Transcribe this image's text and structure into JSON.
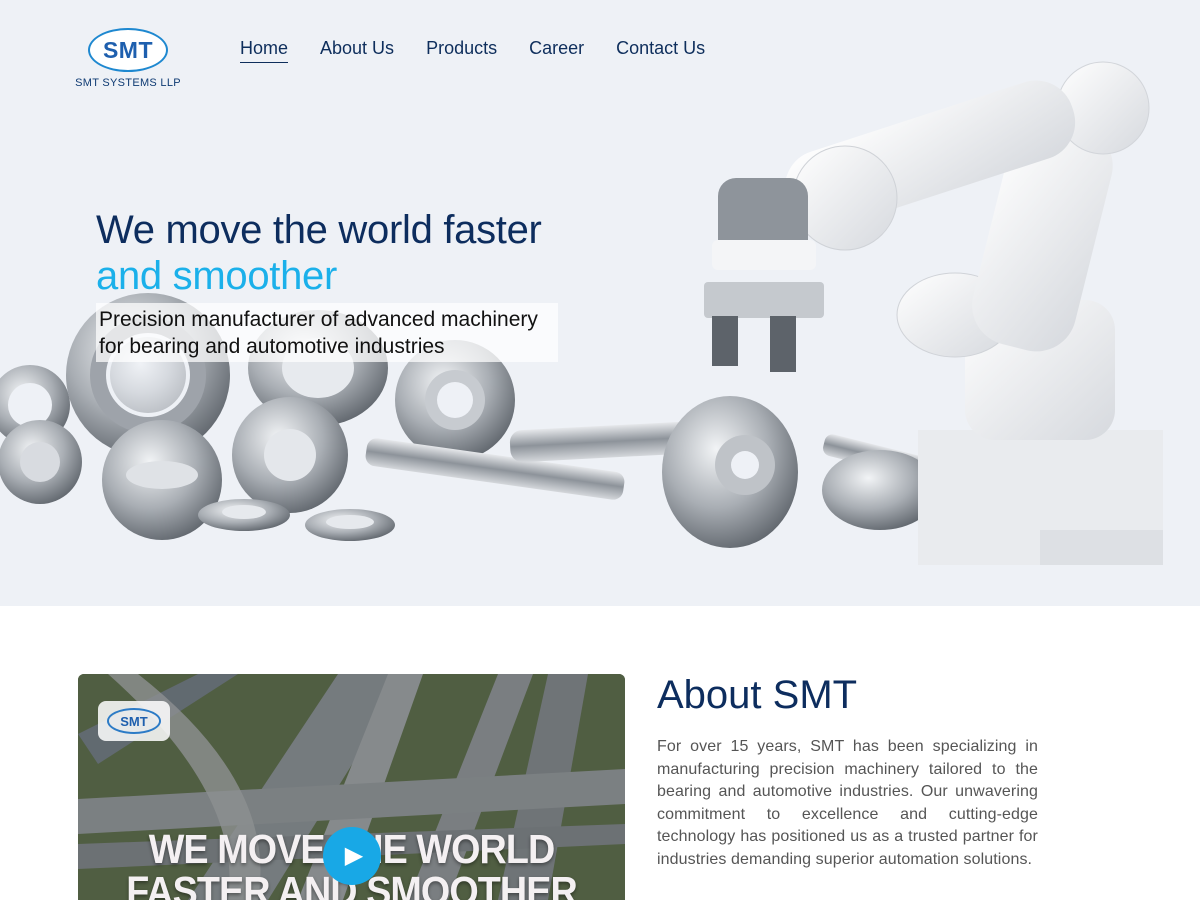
{
  "brand": {
    "logo_text": "SMT",
    "company_name": "SMT SYSTEMS LLP",
    "color_primary": "#0d2d5e",
    "color_accent": "#1bb0ea"
  },
  "nav": {
    "items": [
      {
        "label": "Home",
        "active": true
      },
      {
        "label": "About Us",
        "active": false
      },
      {
        "label": "Products",
        "active": false
      },
      {
        "label": "Career",
        "active": false
      },
      {
        "label": "Contact Us",
        "active": false
      }
    ]
  },
  "hero": {
    "title_line1": "We move the world faster",
    "title_line2": "and smoother",
    "subtitle": "Precision manufacturer of advanced machinery for bearing and automotive industries"
  },
  "video": {
    "logo_text": "SMT",
    "caption_line1": "WE MOVE THE WORLD",
    "caption_line2": "FASTER AND SMOOTHER",
    "play_icon": "play-icon"
  },
  "about": {
    "title": "About SMT",
    "body": "For over 15 years, SMT has been specializing in manufacturing precision machinery tailored to the bearing and automotive industries. Our unwavering commitment to excellence and cutting-edge technology has positioned us as a trusted partner for industries demanding superior automation solutions."
  }
}
